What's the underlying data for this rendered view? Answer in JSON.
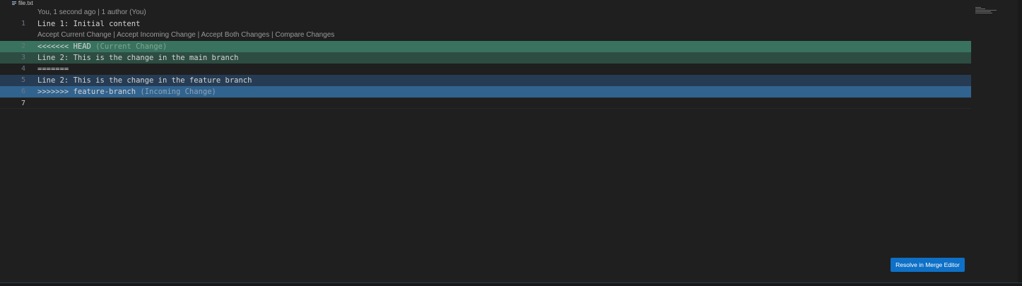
{
  "breadcrumb": {
    "file_icon": "lines-file-icon",
    "file_name": "file.txt"
  },
  "blame": {
    "text": "You, 1 second ago | 1 author (You)"
  },
  "codelens": {
    "accept_current": "Accept Current Change",
    "accept_incoming": "Accept Incoming Change",
    "accept_both": "Accept Both Changes",
    "compare": "Compare Changes",
    "separator": " | "
  },
  "lines": [
    {
      "number": "1",
      "text": "Line 1: Initial content"
    },
    {
      "number": "2",
      "text": "<<<<<<< HEAD",
      "hint": " (Current Change)"
    },
    {
      "number": "3",
      "text": "Line 2: This is the change in the main branch"
    },
    {
      "number": "4",
      "text": "======="
    },
    {
      "number": "5",
      "text": "Line 2: This is the change in the feature branch"
    },
    {
      "number": "6",
      "text": ">>>>>>> feature-branch",
      "hint": " (Incoming Change)"
    },
    {
      "number": "7",
      "text": ""
    }
  ],
  "merge_button": {
    "label": "Resolve in Merge Editor"
  },
  "colors": {
    "current_header": "#39735f",
    "current_body": "#2d4c42",
    "incoming_body": "#263c54",
    "incoming_header": "#31638f",
    "button": "#0e70c6"
  }
}
